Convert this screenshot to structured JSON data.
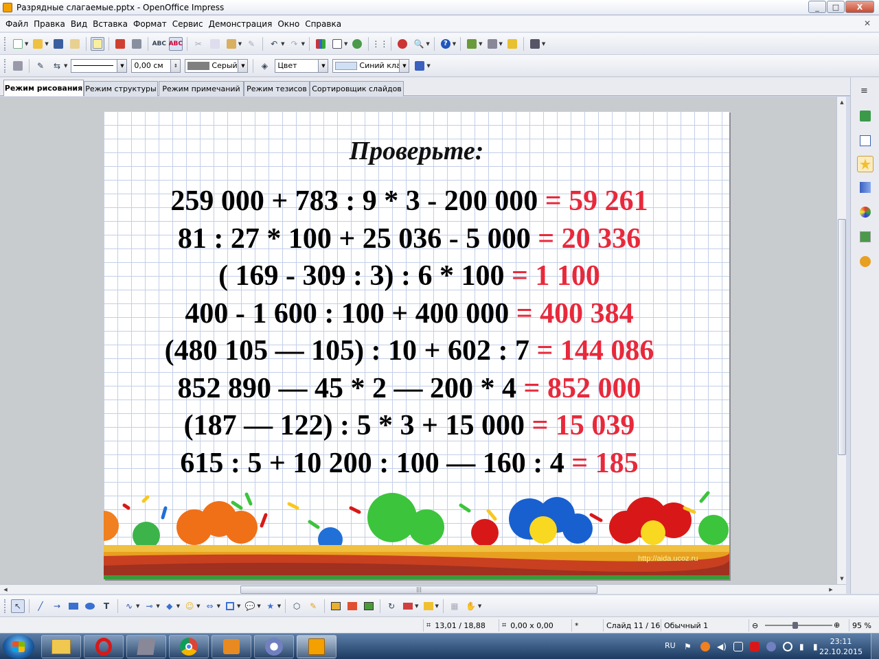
{
  "window": {
    "title": "Разрядные слагаемые.pptx - OpenOffice Impress",
    "controls": [
      "_",
      "□",
      "X"
    ]
  },
  "menu": [
    "Файл",
    "Правка",
    "Вид",
    "Вставка",
    "Формат",
    "Сервис",
    "Демонстрация",
    "Окно",
    "Справка"
  ],
  "line_toolbar": {
    "line_width": "0,00 см",
    "line_color": "Серый",
    "area_style": "Цвет",
    "area_color": "Синий кла"
  },
  "tabs": [
    "Режим рисования",
    "Режим структуры",
    "Режим примечаний",
    "Режим тезисов",
    "Сортировщик слайдов"
  ],
  "slide": {
    "title": "Проверьте:",
    "equations": [
      {
        "expr": "259 000 + 783 : 9 * 3 - 200 000 ",
        "answer": "= 59 261"
      },
      {
        "expr": "81 : 27 * 100 + 25 036 - 5 000 ",
        "answer": "= 20 336"
      },
      {
        "expr": "( 169 - 309 : 3) : 6 * 100 ",
        "answer": "= 1 100"
      },
      {
        "expr": "400 - 1 600 : 100 + 400 000 ",
        "answer": "= 400 384"
      },
      {
        "expr": "(480 105 — 105) : 10 + 602 : 7 ",
        "answer": "= 144 086"
      },
      {
        "expr": "852 890 — 45 * 2 — 200 * 4 ",
        "answer": "= 852 000"
      },
      {
        "expr": "(187 — 122) : 5 * 3 + 15 000 ",
        "answer": "= 15 039"
      },
      {
        "expr": "615 : 5 + 10 200 : 100 — 160 : 4 ",
        "answer": "= 185"
      }
    ],
    "url": "http://aida.ucoz.ru"
  },
  "statusbar": {
    "position": "13,01 / 18,88",
    "size": "0,00 x 0,00",
    "modified": "*",
    "slide": "Слайд 11 / 16",
    "layout": "Обычный 1",
    "zoom": "95 %"
  },
  "taskbar": {
    "language": "RU",
    "time": "23:11",
    "date": "22.10.2015"
  },
  "colors": {
    "answer": "#e8293b",
    "grid": "#c2cfe6",
    "taskbar": "#1c3a61"
  }
}
